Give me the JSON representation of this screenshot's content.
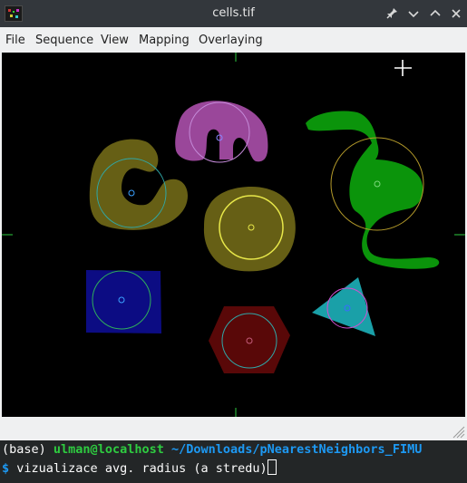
{
  "window": {
    "title": "cells.tif"
  },
  "menu": [
    "File",
    "Sequence",
    "View",
    "Mapping",
    "Overlaying"
  ],
  "terminal": {
    "env": "(base)",
    "user_host": "ulman@localhost",
    "path": "~/Downloads/pNearestNeighbors_FIMU",
    "prompt_symbol": "$",
    "command": "vizualizace avg. radius (a stredu)"
  },
  "icons": {
    "app": "app-icon",
    "pin": "pin-icon",
    "minimize": "chevron-down-icon",
    "maximize": "chevron-up-icon",
    "close": "close-icon",
    "crosshair": "crosshair-cursor-icon",
    "grip": "resize-grip-icon"
  },
  "colors": {
    "titlebar": "#33373c",
    "menubar": "#eff0f1",
    "canvas": "#000000",
    "terminal_bg": "#232627",
    "terminal_green": "#2ecc40",
    "terminal_blue": "#1d99f3"
  }
}
